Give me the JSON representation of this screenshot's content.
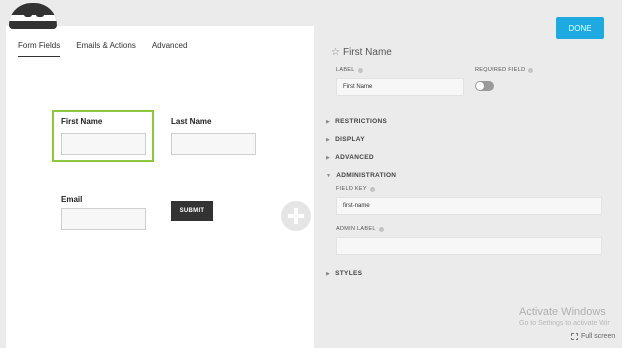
{
  "tabs": [
    {
      "label": "Form Fields",
      "active": true
    },
    {
      "label": "Emails & Actions",
      "active": false
    },
    {
      "label": "Advanced",
      "active": false
    }
  ],
  "builder": {
    "first_name_label": "First Name",
    "last_name_label": "Last Name",
    "email_label": "Email",
    "submit_label": "SUBMIT"
  },
  "panel": {
    "done_label": "DONE",
    "title": "First Name",
    "label_caption": "LABEL",
    "label_value": "First Name",
    "required_caption": "REQUIRED FIELD",
    "required_on": false,
    "sections": {
      "restrictions": "RESTRICTIONS",
      "display": "DISPLAY",
      "advanced": "ADVANCED",
      "administration": "ADMINISTRATION",
      "styles": "STYLES"
    },
    "field_key_caption": "FIELD KEY",
    "field_key_value": "first-name",
    "admin_label_caption": "ADMIN LABEL",
    "admin_label_value": ""
  },
  "system": {
    "watermark_title": "Activate Windows",
    "watermark_sub": "Go to Settings to activate Wir",
    "fullscreen_label": "Full screen"
  },
  "colors": {
    "accent_done": "#1ea9e1",
    "selected_border": "#8dc63f",
    "submit_bg": "#333333"
  }
}
